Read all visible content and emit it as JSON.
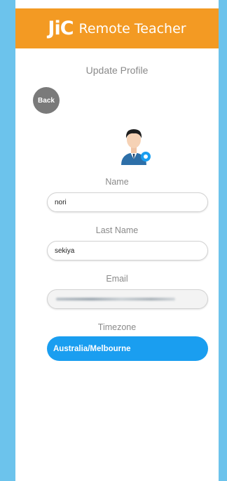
{
  "header": {
    "logo": "JiC",
    "title": "Remote Teacher"
  },
  "page": {
    "title": "Update Profile",
    "back_label": "Back"
  },
  "form": {
    "name_label": "Name",
    "name_value": "nori",
    "last_name_label": "Last Name",
    "last_name_value": "sekiya",
    "email_label": "Email",
    "timezone_label": "Timezone",
    "timezone_value": "Australia/Melbourne"
  },
  "colors": {
    "header": "#f39a23",
    "accent": "#1a9ef0",
    "background": "#6cc3ec",
    "back_button": "#7a7a7a"
  },
  "icons": {
    "avatar": "user-avatar-icon",
    "edit": "edit-badge-icon"
  }
}
